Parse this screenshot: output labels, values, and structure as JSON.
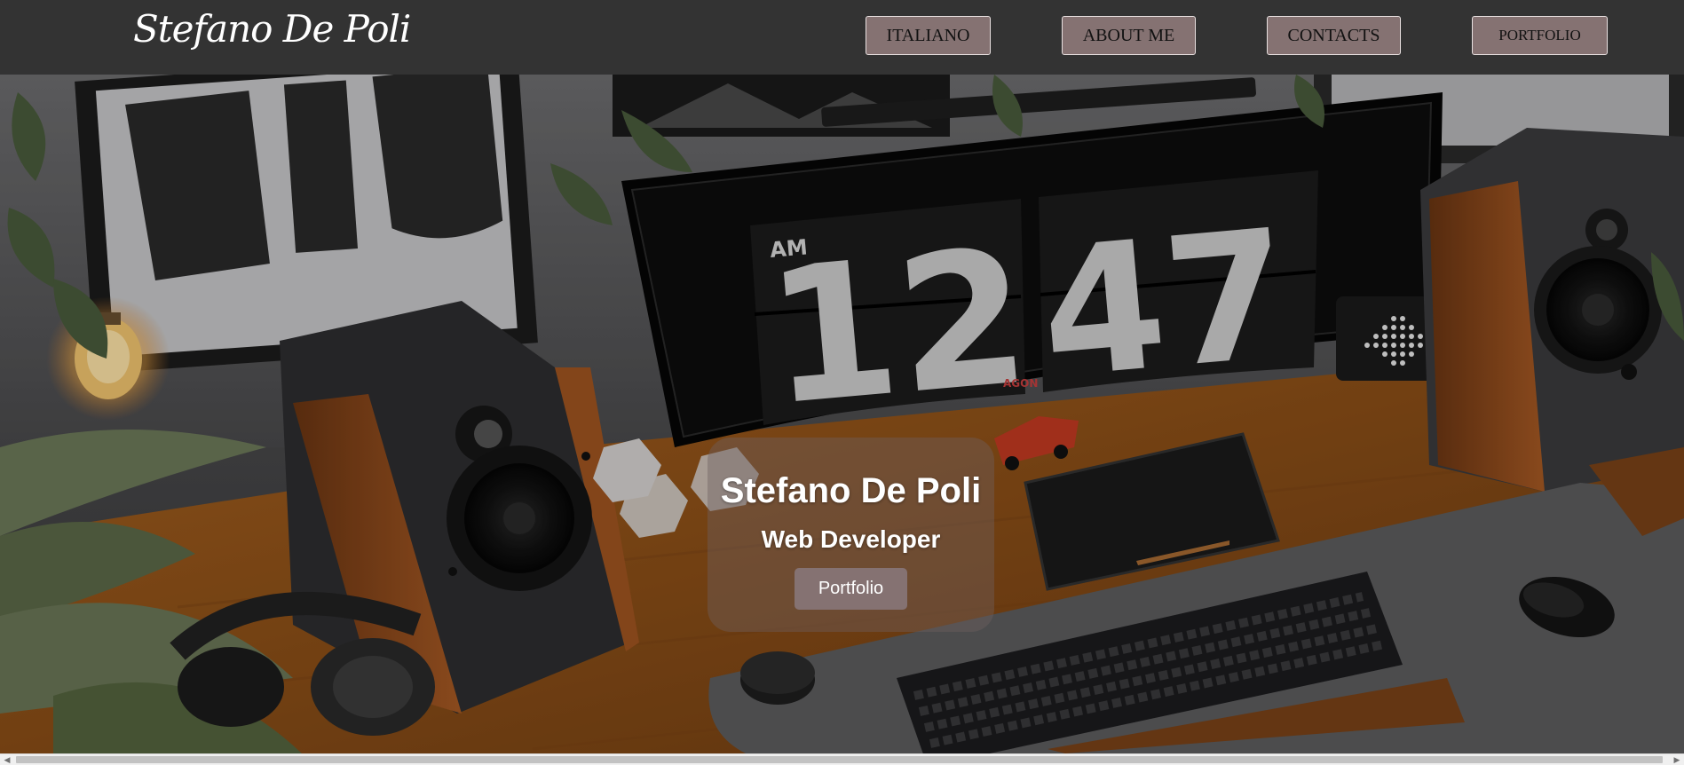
{
  "nav": {
    "brand": "Stefano De Poli",
    "buttons": {
      "italiano": "ITALIANO",
      "about": "ABOUT ME",
      "contacts": "CONTACTS",
      "portfolio": "PORTFOLIO"
    }
  },
  "hero": {
    "name": "Stefano De Poli",
    "role": "Web Developer",
    "cta": "Portfolio",
    "clock": {
      "period": "AM",
      "hours": "12",
      "minutes": "47"
    },
    "monitor_brand": "AGON"
  },
  "scrollbar": {
    "left_arrow": "◀",
    "right_arrow": "▶"
  },
  "colors": {
    "navbar": "#333333",
    "button": "#857272",
    "card": "#6e6060"
  }
}
